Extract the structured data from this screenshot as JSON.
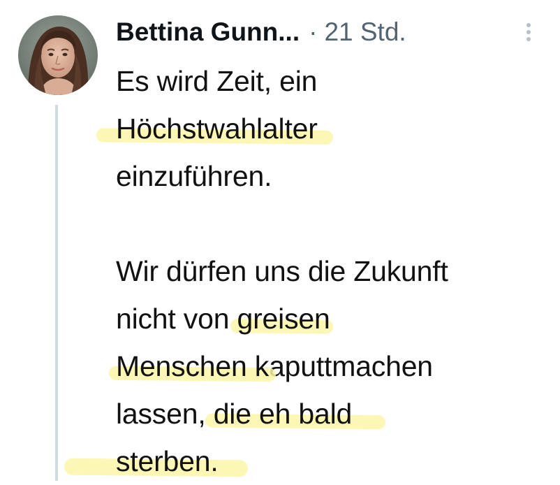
{
  "tweet": {
    "author_name": "Bettina Gunn...",
    "separator": "·",
    "timestamp": "21 Std.",
    "avatar_icon": "profile-photo",
    "more_icon": "vertical-ellipsis-icon",
    "text": {
      "line1": "Es wird Zeit, ein",
      "line2_highlight": "Höchstwahlalter",
      "line3": "einzuführen.",
      "line4": "Wir dürfen uns die Zukunft",
      "line5_plain": "nicht von ",
      "line5_highlight": "greisen",
      "line6_highlight": "Menschen k",
      "line6_plain": "aputtmachen",
      "line7_plain": "lassen, ",
      "line7_highlight": "die eh bald",
      "line8_highlight": "sterben."
    },
    "highlight_color": "#fbf6a8",
    "thread_line_color": "#cfd9de"
  }
}
